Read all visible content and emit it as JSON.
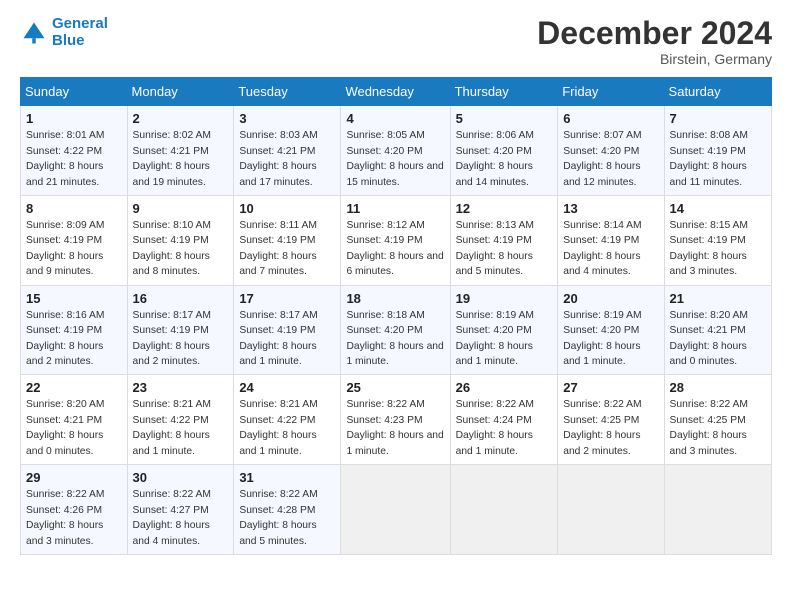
{
  "header": {
    "logo_line1": "General",
    "logo_line2": "Blue",
    "month": "December 2024",
    "location": "Birstein, Germany"
  },
  "weekdays": [
    "Sunday",
    "Monday",
    "Tuesday",
    "Wednesday",
    "Thursday",
    "Friday",
    "Saturday"
  ],
  "weeks": [
    [
      {
        "day": "1",
        "sunrise": "8:01 AM",
        "sunset": "4:22 PM",
        "daylight": "8 hours and 21 minutes."
      },
      {
        "day": "2",
        "sunrise": "8:02 AM",
        "sunset": "4:21 PM",
        "daylight": "8 hours and 19 minutes."
      },
      {
        "day": "3",
        "sunrise": "8:03 AM",
        "sunset": "4:21 PM",
        "daylight": "8 hours and 17 minutes."
      },
      {
        "day": "4",
        "sunrise": "8:05 AM",
        "sunset": "4:20 PM",
        "daylight": "8 hours and 15 minutes."
      },
      {
        "day": "5",
        "sunrise": "8:06 AM",
        "sunset": "4:20 PM",
        "daylight": "8 hours and 14 minutes."
      },
      {
        "day": "6",
        "sunrise": "8:07 AM",
        "sunset": "4:20 PM",
        "daylight": "8 hours and 12 minutes."
      },
      {
        "day": "7",
        "sunrise": "8:08 AM",
        "sunset": "4:19 PM",
        "daylight": "8 hours and 11 minutes."
      }
    ],
    [
      {
        "day": "8",
        "sunrise": "8:09 AM",
        "sunset": "4:19 PM",
        "daylight": "8 hours and 9 minutes."
      },
      {
        "day": "9",
        "sunrise": "8:10 AM",
        "sunset": "4:19 PM",
        "daylight": "8 hours and 8 minutes."
      },
      {
        "day": "10",
        "sunrise": "8:11 AM",
        "sunset": "4:19 PM",
        "daylight": "8 hours and 7 minutes."
      },
      {
        "day": "11",
        "sunrise": "8:12 AM",
        "sunset": "4:19 PM",
        "daylight": "8 hours and 6 minutes."
      },
      {
        "day": "12",
        "sunrise": "8:13 AM",
        "sunset": "4:19 PM",
        "daylight": "8 hours and 5 minutes."
      },
      {
        "day": "13",
        "sunrise": "8:14 AM",
        "sunset": "4:19 PM",
        "daylight": "8 hours and 4 minutes."
      },
      {
        "day": "14",
        "sunrise": "8:15 AM",
        "sunset": "4:19 PM",
        "daylight": "8 hours and 3 minutes."
      }
    ],
    [
      {
        "day": "15",
        "sunrise": "8:16 AM",
        "sunset": "4:19 PM",
        "daylight": "8 hours and 2 minutes."
      },
      {
        "day": "16",
        "sunrise": "8:17 AM",
        "sunset": "4:19 PM",
        "daylight": "8 hours and 2 minutes."
      },
      {
        "day": "17",
        "sunrise": "8:17 AM",
        "sunset": "4:19 PM",
        "daylight": "8 hours and 1 minute."
      },
      {
        "day": "18",
        "sunrise": "8:18 AM",
        "sunset": "4:20 PM",
        "daylight": "8 hours and 1 minute."
      },
      {
        "day": "19",
        "sunrise": "8:19 AM",
        "sunset": "4:20 PM",
        "daylight": "8 hours and 1 minute."
      },
      {
        "day": "20",
        "sunrise": "8:19 AM",
        "sunset": "4:20 PM",
        "daylight": "8 hours and 1 minute."
      },
      {
        "day": "21",
        "sunrise": "8:20 AM",
        "sunset": "4:21 PM",
        "daylight": "8 hours and 0 minutes."
      }
    ],
    [
      {
        "day": "22",
        "sunrise": "8:20 AM",
        "sunset": "4:21 PM",
        "daylight": "8 hours and 0 minutes."
      },
      {
        "day": "23",
        "sunrise": "8:21 AM",
        "sunset": "4:22 PM",
        "daylight": "8 hours and 1 minute."
      },
      {
        "day": "24",
        "sunrise": "8:21 AM",
        "sunset": "4:22 PM",
        "daylight": "8 hours and 1 minute."
      },
      {
        "day": "25",
        "sunrise": "8:22 AM",
        "sunset": "4:23 PM",
        "daylight": "8 hours and 1 minute."
      },
      {
        "day": "26",
        "sunrise": "8:22 AM",
        "sunset": "4:24 PM",
        "daylight": "8 hours and 1 minute."
      },
      {
        "day": "27",
        "sunrise": "8:22 AM",
        "sunset": "4:25 PM",
        "daylight": "8 hours and 2 minutes."
      },
      {
        "day": "28",
        "sunrise": "8:22 AM",
        "sunset": "4:25 PM",
        "daylight": "8 hours and 3 minutes."
      }
    ],
    [
      {
        "day": "29",
        "sunrise": "8:22 AM",
        "sunset": "4:26 PM",
        "daylight": "8 hours and 3 minutes."
      },
      {
        "day": "30",
        "sunrise": "8:22 AM",
        "sunset": "4:27 PM",
        "daylight": "8 hours and 4 minutes."
      },
      {
        "day": "31",
        "sunrise": "8:22 AM",
        "sunset": "4:28 PM",
        "daylight": "8 hours and 5 minutes."
      },
      null,
      null,
      null,
      null
    ]
  ]
}
